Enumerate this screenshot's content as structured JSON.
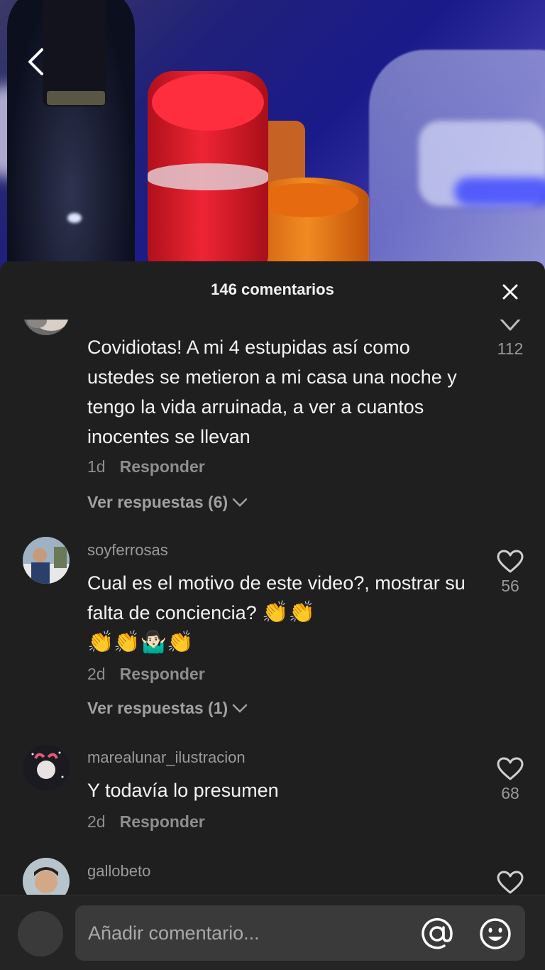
{
  "video": {
    "back_icon": "chevron-left-icon"
  },
  "sheet": {
    "title": "146 comentarios",
    "close_icon": "close-icon"
  },
  "comments": [
    {
      "username": "",
      "text": "Covidiotas! A mi 4 estupidas así como ustedes se metieron a mi casa una noche y tengo la vida arruinada, a ver a cuantos inocentes se llevan",
      "time": "1d",
      "reply_label": "Responder",
      "likes": "112",
      "view_replies": "Ver respuestas (6)"
    },
    {
      "username": "soyferrosas",
      "text": "Cual es el motivo de este video?, mostrar su falta de conciencia?",
      "emojis_line1": "👏👏",
      "emojis_line2": "👏👏🤷🏻‍♂️👏",
      "time": "2d",
      "reply_label": "Responder",
      "likes": "56",
      "view_replies": "Ver respuestas (1)"
    },
    {
      "username": "marealunar_ilustracion",
      "text": "Y todavía lo presumen",
      "time": "2d",
      "reply_label": "Responder",
      "likes": "68"
    },
    {
      "username": "gallobeto"
    }
  ],
  "input": {
    "placeholder": "Añadir comentario...",
    "mention_icon": "at-icon",
    "emoji_icon": "emoji-icon"
  },
  "colors": {
    "sheet_bg": "#1f1f1f",
    "input_bg": "#3a3a3a",
    "text_primary": "#f4f4f4",
    "text_secondary": "#8e8e8e"
  }
}
